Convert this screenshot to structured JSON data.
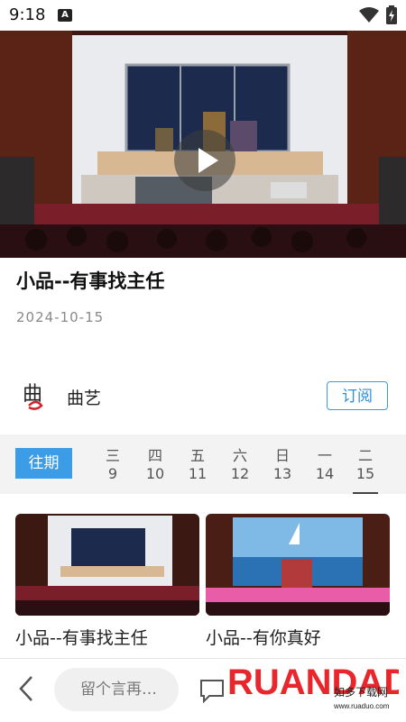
{
  "status_bar": {
    "time": "9:18",
    "notification_icon": "A",
    "wifi_icon": "wifi-icon",
    "battery_icon": "battery-icon"
  },
  "video": {
    "play_icon": "play-icon"
  },
  "program": {
    "title": "小品--有事找主任",
    "date": "2024-10-15"
  },
  "channel": {
    "name": "曲艺",
    "logo_text": "曲",
    "subscribe_label": "订阅"
  },
  "date_strip": {
    "past_label": "往期",
    "days": [
      {
        "weekday": "三",
        "day": "9"
      },
      {
        "weekday": "四",
        "day": "10"
      },
      {
        "weekday": "五",
        "day": "11"
      },
      {
        "weekday": "六",
        "day": "12"
      },
      {
        "weekday": "日",
        "day": "13"
      },
      {
        "weekday": "一",
        "day": "14"
      },
      {
        "weekday": "二",
        "day": "15"
      }
    ],
    "selected_index": 6
  },
  "episodes": [
    {
      "title": "小品--有事找主任"
    },
    {
      "title": "小品--有你真好"
    }
  ],
  "bottom_bar": {
    "comment_placeholder": "留个言再…"
  },
  "watermark": {
    "brand": "RUANDADO",
    "slogan": "如多下载网",
    "url": "www.ruaduo.com"
  },
  "colors": {
    "accent": "#3c9de6",
    "watermark_red": "#e8262b"
  }
}
